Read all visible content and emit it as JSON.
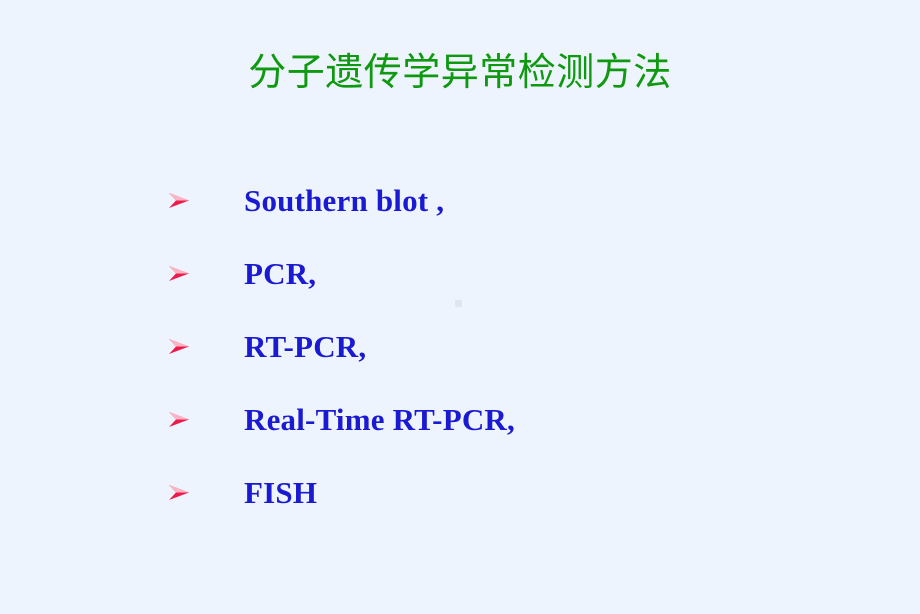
{
  "slide": {
    "background_color": "#eef4fd",
    "title": "分子遗传学异常检测方法",
    "title_color": "#0f9910",
    "bullet_marker_icon": "arrowhead-bullet-icon",
    "bullet_marker_color": "#ec1b4b",
    "bullet_text_color": "#1a1ad2",
    "bullets": [
      {
        "label": "Southern blot ,"
      },
      {
        "label": "PCR,"
      },
      {
        "label": "RT-PCR,"
      },
      {
        "label": "Real-Time RT-PCR,"
      },
      {
        "label": "FISH"
      }
    ]
  }
}
